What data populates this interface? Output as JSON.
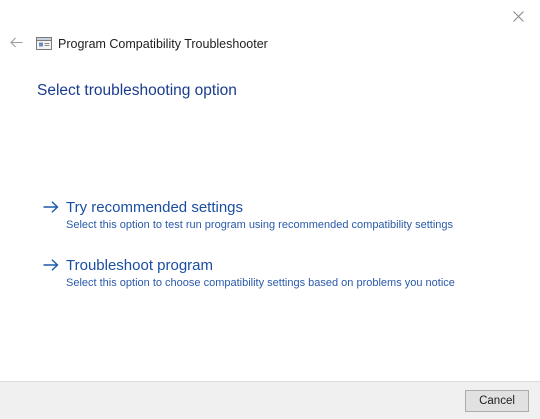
{
  "window": {
    "title": "Program Compatibility Troubleshooter",
    "back_icon": "back-arrow-icon",
    "close_icon": "close-icon",
    "app_icon": "troubleshooter-window-icon"
  },
  "main": {
    "heading": "Select troubleshooting option",
    "options": [
      {
        "label": "Try recommended settings",
        "description": "Select this option to test run program using recommended compatibility settings",
        "icon": "arrow-right-icon"
      },
      {
        "label": "Troubleshoot program",
        "description": "Select this option to choose compatibility settings based on problems you notice",
        "icon": "arrow-right-icon"
      }
    ]
  },
  "footer": {
    "cancel_label": "Cancel"
  },
  "colors": {
    "heading": "#1a3c8c",
    "link": "#1a4fa0",
    "footer_bg": "#f0f0f0"
  }
}
